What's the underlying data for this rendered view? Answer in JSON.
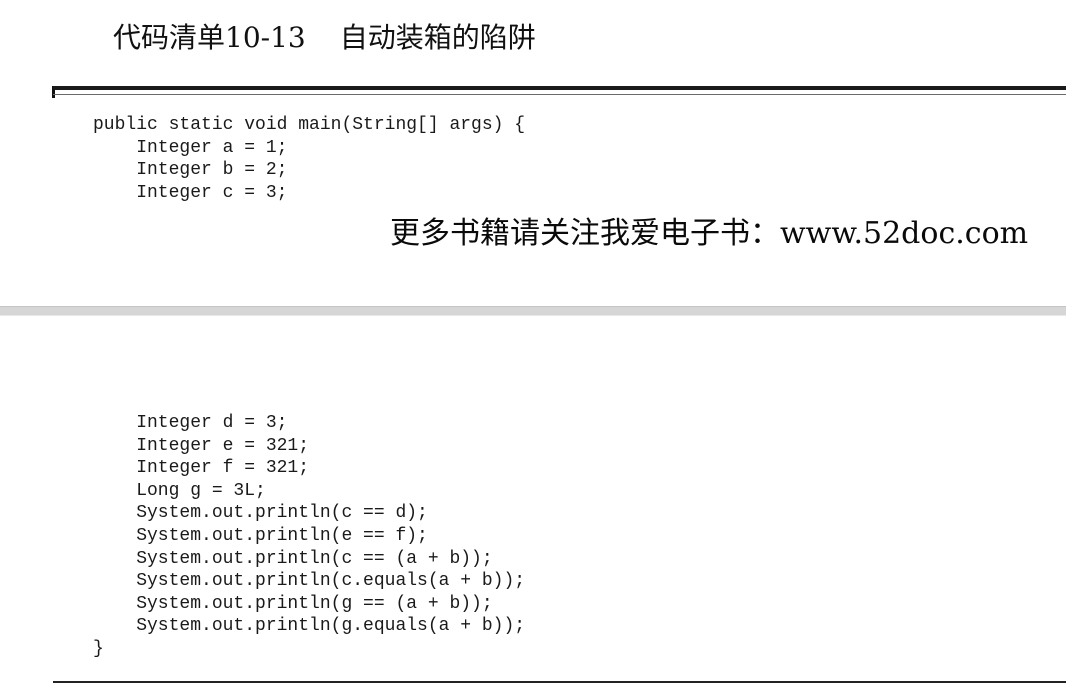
{
  "listing": {
    "label": "代码清单10-13",
    "title": "自动装箱的陷阱"
  },
  "code": {
    "part1": [
      "public static void main(String[] args) {",
      "    Integer a = 1;",
      "    Integer b = 2;",
      "    Integer c = 3;"
    ],
    "part2": [
      "    Integer d = 3;",
      "    Integer e = 321;",
      "    Integer f = 321;",
      "    Long g = 3L;",
      "    System.out.println(c == d);",
      "    System.out.println(e == f);",
      "    System.out.println(c == (a + b));",
      "    System.out.println(c.equals(a + b));",
      "    System.out.println(g == (a + b));",
      "    System.out.println(g.equals(a + b));",
      "}"
    ]
  },
  "watermark": {
    "text": "更多书籍请关注我爱电子书：www.52doc.com"
  }
}
